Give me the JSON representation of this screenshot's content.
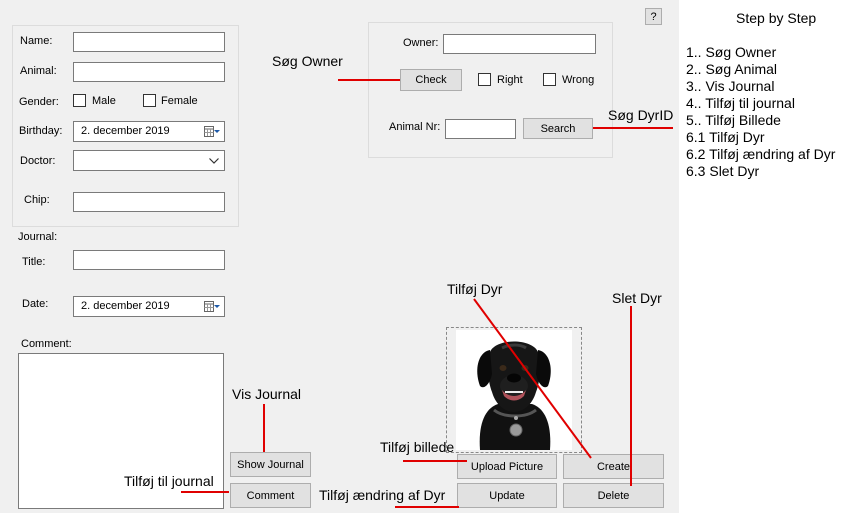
{
  "form": {
    "help_button": "?",
    "animal_group": {
      "name_label": "Name:",
      "name_value": "",
      "animal_label": "Animal:",
      "animal_value": "",
      "gender_label": "Gender:",
      "male_label": "Male",
      "female_label": "Female",
      "birthday_label": "Birthday:",
      "birthday_value": "2. december 2019",
      "doctor_label": "Doctor:",
      "doctor_value": "",
      "chip_label": "Chip:",
      "chip_value": ""
    },
    "journal": {
      "section_label": "Journal:",
      "title_label": "Title:",
      "title_value": "",
      "date_label": "Date:",
      "date_value": "2. december 2019",
      "comment_label": "Comment:",
      "comment_value": ""
    },
    "owner_group": {
      "owner_label": "Owner:",
      "owner_value": "",
      "check_label": "Check",
      "right_label": "Right",
      "wrong_label": "Wrong",
      "animal_nr_label": "Animal Nr:",
      "animal_nr_value": "",
      "search_label": "Search"
    },
    "buttons": {
      "show_journal": "Show Journal",
      "comment": "Comment",
      "upload_picture": "Upload Picture",
      "create": "Create",
      "update": "Update",
      "delete": "Delete"
    },
    "picture": {
      "icon": "black-labrador-photo"
    }
  },
  "annotations": {
    "sog_owner": "Søg Owner",
    "sog_dyrid": "Søg DyrID",
    "tilfoj_dyr": "Tilføj Dyr",
    "slet_dyr": "Slet Dyr",
    "vis_journal": "Vis Journal",
    "tilfoj_billede": "Tilføj billede",
    "tilfoj_til_journal": "Tilføj til journal",
    "tilfoj_aendring": "Tilføj ændring af Dyr",
    "color": "#e00000"
  },
  "steps": {
    "title": "Step by Step",
    "items": [
      "1.. Søg Owner",
      "2.. Søg Animal",
      "3.. Vis Journal",
      "4.. Tilføj til journal",
      "5.. Tilføj Billede",
      "6.1 Tilføj Dyr",
      "6.2 Tilføj ændring af Dyr",
      "6.3 Slet Dyr"
    ]
  }
}
